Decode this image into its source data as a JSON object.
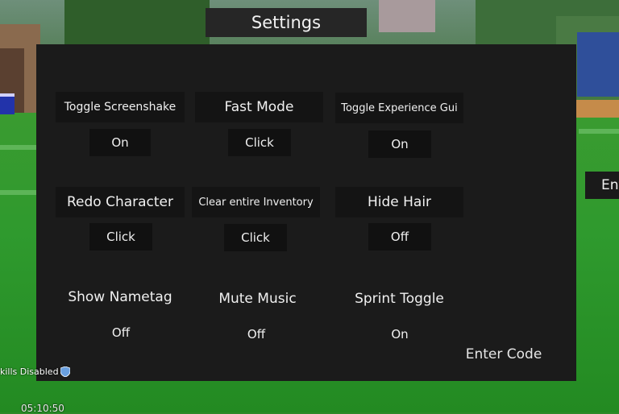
{
  "title": "Settings",
  "options": [
    {
      "label": "Toggle Screenshake",
      "value": "On"
    },
    {
      "label": "Fast Mode",
      "value": "Click"
    },
    {
      "label": "Toggle Experience Gui",
      "value": "On"
    },
    {
      "label": "Redo Character",
      "value": "Click"
    },
    {
      "label": "Clear entire Inventory",
      "value": "Click"
    },
    {
      "label": "Hide Hair",
      "value": "Off"
    },
    {
      "label": "Show Nametag",
      "value": "Off"
    },
    {
      "label": "Mute Music",
      "value": "Off"
    },
    {
      "label": "Sprint Toggle",
      "value": "On"
    }
  ],
  "enter_code": "Enter Code",
  "side_tab": "Ent",
  "status": {
    "text": "kills Disabled",
    "icon": "shield-icon"
  },
  "timer": "05:10:50"
}
